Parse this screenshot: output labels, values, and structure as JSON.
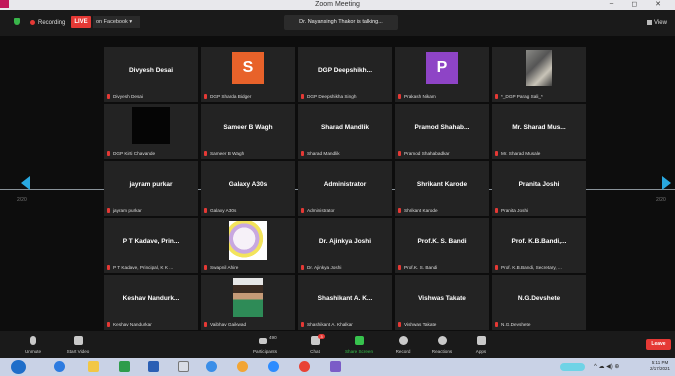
{
  "window": {
    "title": "Zoom Meeting",
    "controls": "− ◻ ✕"
  },
  "topbar": {
    "recording_label": "Recording",
    "live_label": "LIVE",
    "live_destination": "on Facebook ▾",
    "talking": "Dr. Nayansingh Thakor is talking...",
    "view_label": "View"
  },
  "page_indicator": {
    "left": "2/20",
    "right": "2/20"
  },
  "tiles": [
    {
      "display": "Divyesh Desai",
      "label": "Divyesh Desai"
    },
    {
      "avatar_letter": "S",
      "avatar_color": "#e8622a",
      "label": "DGP Sharda Bidger"
    },
    {
      "display": "DGP Deepshikh...",
      "label": "DGP Deepshikha Singh"
    },
    {
      "avatar_letter": "P",
      "avatar_color": "#8e44c6",
      "label": "Prakash Nikam"
    },
    {
      "photo": "room-photo",
      "label": "*_DGP Parag Sali_*"
    },
    {
      "photo": "dark-photo",
      "label": "DGP Kirti Chavande"
    },
    {
      "display": "Sameer B Wagh",
      "label": "Sameer B Wagh"
    },
    {
      "display": "Sharad Mandlik",
      "label": "Sharad Mandlik"
    },
    {
      "display": "Pramod Shahab...",
      "label": "Pramod Shahabadkar"
    },
    {
      "display": "Mr. Sharad Mus...",
      "label": "Mr. Sharad Musale"
    },
    {
      "display": "jayram purkar",
      "label": "jayram purkar"
    },
    {
      "display": "Galaxy A30s",
      "label": "Galaxy A30s"
    },
    {
      "display": "Administrator",
      "label": "Administrator"
    },
    {
      "display": "Shrikant Karode",
      "label": "Shrikant Karode"
    },
    {
      "display": "Pranita Joshi",
      "label": "Pranita Joshi"
    },
    {
      "display": "P T Kadave, Prin...",
      "label": "P T Kadave, Principal, K K ..."
    },
    {
      "photo": "cartoon-photo",
      "label": "Swapnil Ahire"
    },
    {
      "display": "Dr. Ajinkya Joshi",
      "label": "Dr. Ajinkya Joshi"
    },
    {
      "display": "Prof.K. S. Bandi",
      "label": "Prof.K. S. Bandi"
    },
    {
      "display": "Prof. K.B.Bandi,...",
      "label": "Prof. K.B.Bandi, Secretary, ..."
    },
    {
      "display": "Keshav Nandurk...",
      "label": "Keshav Nandurkar"
    },
    {
      "photo": "person-photo",
      "label": "Vaibhav Gaikwad"
    },
    {
      "display": "Shashikant A. K...",
      "label": "Shashikant A. Khalkar"
    },
    {
      "display": "Vishwas Takate",
      "label": "Vishwas Takate"
    },
    {
      "display": "N.G.Devshete",
      "label": "N.G.Devshete"
    }
  ],
  "toolbar": {
    "unmute": "Unmute",
    "start_video": "Start Video",
    "participants": "Participants",
    "participants_count": "490",
    "chat": "Chat",
    "chat_badge": "3",
    "share_screen": "Share Screen",
    "record": "Record",
    "reactions": "Reactions",
    "apps": "Apps",
    "end": "Leave"
  },
  "taskbar": {
    "tray_icons": "^ ☁ ◀) ⊕",
    "time": "5:11 PM",
    "date": "2/17/2021"
  },
  "colors": {
    "accent": "#29a8e0",
    "mute": "#e53935",
    "share": "#37c24d"
  }
}
